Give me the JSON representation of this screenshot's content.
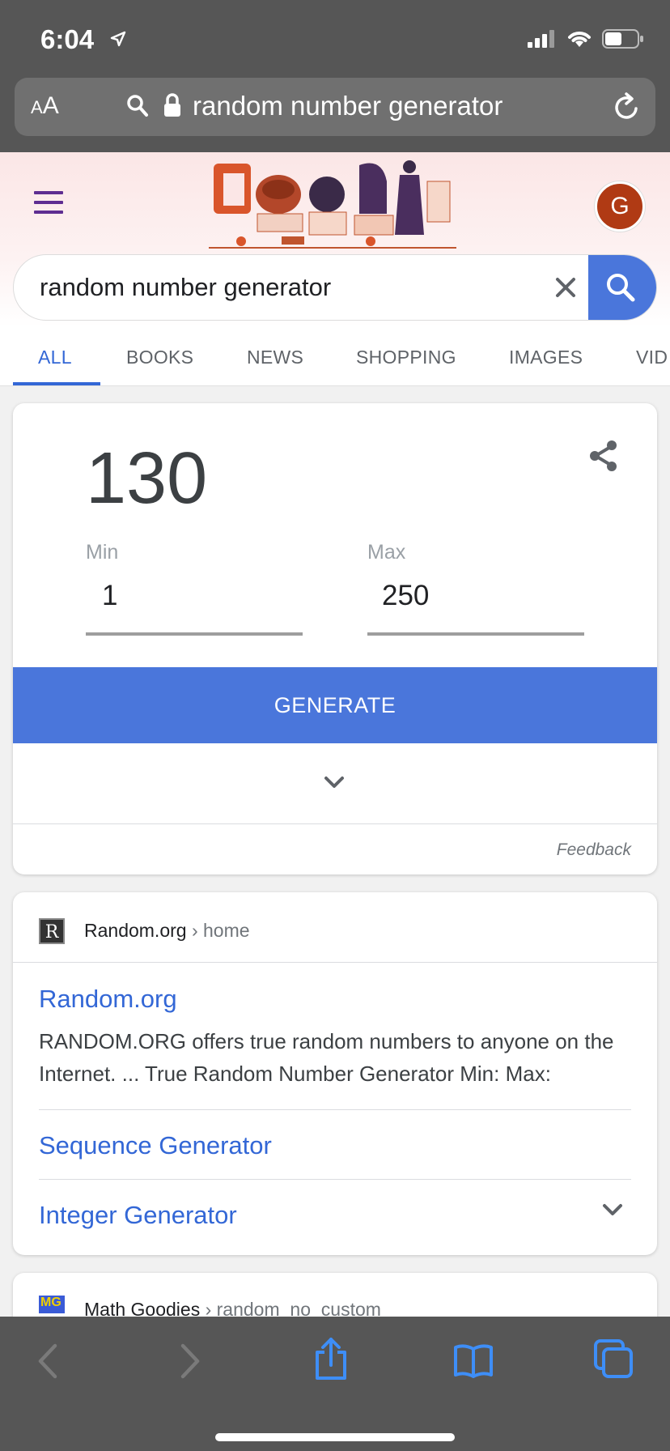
{
  "status_bar": {
    "time": "6:04"
  },
  "safari": {
    "text_size_label": "AA",
    "url_text": "random number generator"
  },
  "google": {
    "avatar_initial": "G",
    "search_query": "random number generator",
    "tabs": [
      {
        "label": "ALL"
      },
      {
        "label": "BOOKS"
      },
      {
        "label": "NEWS"
      },
      {
        "label": "SHOPPING"
      },
      {
        "label": "IMAGES"
      },
      {
        "label": "VID"
      }
    ]
  },
  "rng": {
    "result": "130",
    "min_label": "Min",
    "min_value": "1",
    "max_label": "Max",
    "max_value": "250",
    "generate_label": "GENERATE",
    "feedback_label": "Feedback"
  },
  "results": [
    {
      "favicon_letter": "R",
      "site": "Random.org",
      "path": " › home",
      "title": "Random.org",
      "snippet": "RANDOM.ORG offers true random numbers to anyone on the Internet. ... True Random Number Generator Min: Max:",
      "sublinks": [
        "Sequence Generator",
        "Integer Generator"
      ]
    },
    {
      "favicon_letter": "MG",
      "site": "Math Goodies",
      "path": " › random_no_custom"
    }
  ],
  "colors": {
    "brand_blue": "#4a76db",
    "link_blue": "#3367d6",
    "avatar_bg": "#b03a14",
    "chrome_gray": "#565656"
  }
}
